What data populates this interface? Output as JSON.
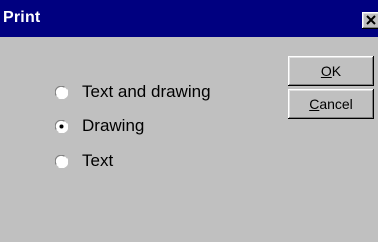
{
  "dialog": {
    "title": "Print",
    "close_glyph": "×"
  },
  "options": [
    {
      "label": "Text and drawing",
      "selected": false
    },
    {
      "label": "Drawing",
      "selected": true
    },
    {
      "label": "Text",
      "selected": false
    }
  ],
  "buttons": {
    "ok_label": "OK",
    "cancel_label": "Cancel"
  },
  "colors": {
    "title_bar": "#000080",
    "face": "#c0c0c0"
  }
}
